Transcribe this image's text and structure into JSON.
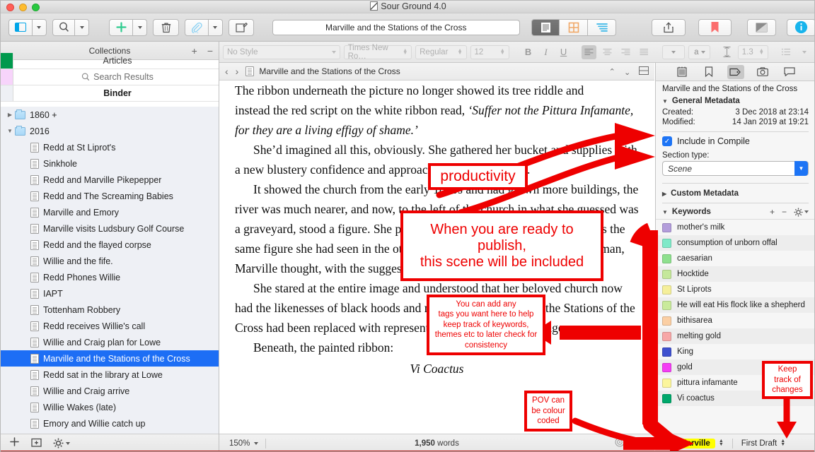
{
  "window": {
    "title": "Sour Ground 4.0",
    "doc_title_field": "Marville and the Stations of the Cross"
  },
  "toolbar": {
    "view_layout_icon": "sidebar-icon",
    "search_icon": "search-icon",
    "add_icon": "plus-icon",
    "trash_icon": "trash-icon",
    "attach_icon": "paperclip-icon",
    "compose_icon": "compose-icon",
    "seg_document_icon": "document-view-icon",
    "seg_corkboard_icon": "corkboard-view-icon",
    "seg_outline_icon": "outline-view-icon",
    "share_icon": "share-icon",
    "bookmark_icon": "bookmark-icon",
    "composition_icon": "composition-mode-icon",
    "inspector_icon": "info-icon"
  },
  "formatbar": {
    "style": "No Style",
    "font": "Times New Ro…",
    "weight": "Regular",
    "size": "12",
    "bold": "B",
    "italic": "I",
    "underline": "U",
    "align_left": "align-left-icon",
    "align_center": "align-center-icon",
    "align_right": "align-right-icon",
    "align_justify": "align-justify-icon",
    "text_color": "a",
    "line_height": "1.3",
    "list": "list-icon"
  },
  "collections": {
    "header": "Collections",
    "add": "+",
    "remove": "−",
    "rows": [
      {
        "label": "Articles",
        "color": "#00994d",
        "bold": false
      },
      {
        "label": "Search Results",
        "color": "#f7d4fb",
        "bold": false,
        "icon": "search-icon"
      },
      {
        "label": "Binder",
        "color": "#eef0f5",
        "bold": true
      }
    ]
  },
  "binder": {
    "items": [
      {
        "label": "1860 +",
        "type": "folder",
        "depth": 0,
        "disclosure": "collapsed",
        "selected": false
      },
      {
        "label": "2016",
        "type": "folder",
        "depth": 0,
        "disclosure": "expanded",
        "selected": false
      },
      {
        "label": "Redd at St Liprot's",
        "type": "doc",
        "depth": 1,
        "selected": false
      },
      {
        "label": "Sinkhole",
        "type": "doc",
        "depth": 1,
        "selected": false
      },
      {
        "label": "Redd and Marville Pikepepper",
        "type": "doc",
        "depth": 1,
        "selected": false
      },
      {
        "label": "Redd and The Screaming Babies",
        "type": "doc",
        "depth": 1,
        "selected": false
      },
      {
        "label": "Marville and Emory",
        "type": "doc",
        "depth": 1,
        "selected": false
      },
      {
        "label": "Marville visits Ludsbury Golf Course",
        "type": "doc",
        "depth": 1,
        "selected": false
      },
      {
        "label": "Redd and the flayed corpse",
        "type": "doc",
        "depth": 1,
        "selected": false
      },
      {
        "label": "Willie and the fife.",
        "type": "doc",
        "depth": 1,
        "selected": false
      },
      {
        "label": "Redd Phones Willie",
        "type": "doc",
        "depth": 1,
        "selected": false
      },
      {
        "label": "IAPT",
        "type": "doc",
        "depth": 1,
        "selected": false
      },
      {
        "label": "Tottenham Robbery",
        "type": "doc",
        "depth": 1,
        "selected": false
      },
      {
        "label": "Redd receives Willie's call",
        "type": "doc",
        "depth": 1,
        "selected": false
      },
      {
        "label": "Willie and Craig plan for Lowe",
        "type": "doc",
        "depth": 1,
        "selected": false
      },
      {
        "label": "Marville and the Stations of the Cross",
        "type": "doc",
        "depth": 1,
        "selected": true
      },
      {
        "label": "Redd sat in the library at Lowe",
        "type": "doc",
        "depth": 1,
        "selected": false
      },
      {
        "label": "Willie and Craig arrive",
        "type": "doc",
        "depth": 1,
        "selected": false
      },
      {
        "label": "Willie Wakes (late)",
        "type": "doc",
        "depth": 1,
        "selected": false
      },
      {
        "label": "Emory and Willie catch up",
        "type": "doc",
        "depth": 1,
        "selected": false
      }
    ],
    "footer": {
      "add_icon": "plus-icon",
      "add_folder_icon": "new-folder-icon",
      "gear_icon": "gear-icon"
    }
  },
  "editor": {
    "header_title": "Marville and the Stations of the Cross",
    "back_icon": "chevron-left-icon",
    "forward_icon": "chevron-right-icon",
    "doc_icon": "document-icon",
    "prev_icon": "chevron-up-icon",
    "next_icon": "chevron-down-icon",
    "split_icon": "split-view-icon",
    "paragraphs": [
      "The ribbon underneath the picture no longer showed its tree riddle and",
      "instead the red script on the white ribbon read, ",
      "‘Suffer not the Pittura Infamante, for they are a living effigy of shame.’",
      "She’d imagined all this, obviously. She gathered her bucket and supplies with a new blustery confidence and approached the final picture.",
      "It showed the church from the early 1800s and had grown more buildings, the river was much nearer, and now, to the left of the church in what she guessed was a graveyard, stood a figure. She peeked closer as she dusted and saw it was the same figure she had seen in the other painting. This could have been a woman, Marville thought, with the suggestion of breasts below the stump.",
      "She stared at the entire image and understood that her beloved church now had the likenesses of black hoods and more, and that was why the Stations of the Cross had been replaced with representations of monstrous savagery.",
      "Beneath, the painted ribbon:",
      "Vi Coactus"
    ],
    "footer": {
      "zoom": "150%",
      "word_count_number": "1,950",
      "word_count_label": "words",
      "target_icon": "target-icon",
      "fullscreen_icon": "fullscreen-icon"
    }
  },
  "inspector": {
    "tabs": [
      {
        "name": "notes-tab",
        "icon": "notepad-icon",
        "active": false
      },
      {
        "name": "bookmarks-tab",
        "icon": "bookmark-icon",
        "active": false
      },
      {
        "name": "metadata-tab",
        "icon": "tag-icon",
        "active": true
      },
      {
        "name": "snapshots-tab",
        "icon": "camera-icon",
        "active": false
      },
      {
        "name": "comments-tab",
        "icon": "comment-icon",
        "active": false
      }
    ],
    "doc_title": "Marville and the Stations of the Cross",
    "general_metadata_label": "General Metadata",
    "created_label": "Created:",
    "created_value": "3 Dec 2018 at 23:14",
    "modified_label": "Modified:",
    "modified_value": "14 Jan 2019 at 19:21",
    "include_in_compile": "Include in Compile",
    "include_checked": true,
    "section_type_label": "Section type:",
    "section_type_value": "Scene",
    "custom_metadata_label": "Custom Metadata",
    "keywords_label": "Keywords",
    "keywords_add": "+",
    "keywords_remove": "−",
    "keywords_gear": "gear-icon",
    "keywords": [
      {
        "label": "mother's milk",
        "color": "#b39ddb"
      },
      {
        "label": "consumption of unborn offal",
        "color": "#7fe9c8"
      },
      {
        "label": "caesarian",
        "color": "#8ee08e"
      },
      {
        "label": "Hocktide",
        "color": "#c5e89a"
      },
      {
        "label": "St Liprots",
        "color": "#f5ef9a"
      },
      {
        "label": "He will eat His flock like a shepherd",
        "color": "#c9ea9b"
      },
      {
        "label": "bithisarea",
        "color": "#fbcfa4"
      },
      {
        "label": "melting gold",
        "color": "#f7a7a7"
      },
      {
        "label": "King",
        "color": "#3f51cf"
      },
      {
        "label": "gold",
        "color": "#f43ef4"
      },
      {
        "label": "pittura infamante",
        "color": "#fbf59c"
      },
      {
        "label": "Vi coactus",
        "color": "#00a86b"
      }
    ],
    "footer": {
      "pov": "Marville",
      "status": "First Draft"
    }
  },
  "annotations": [
    {
      "id": "productivity",
      "text": "productivity"
    },
    {
      "id": "publish",
      "text": "When you are ready to publish,\nthis scene will be included"
    },
    {
      "id": "tags",
      "text": "You can add any tags you want here to help keep track of keywords, themes etc to later check for consistency"
    },
    {
      "id": "pov",
      "text": "POV can be colour coded"
    },
    {
      "id": "changes",
      "text": "Keep track of changes"
    }
  ]
}
